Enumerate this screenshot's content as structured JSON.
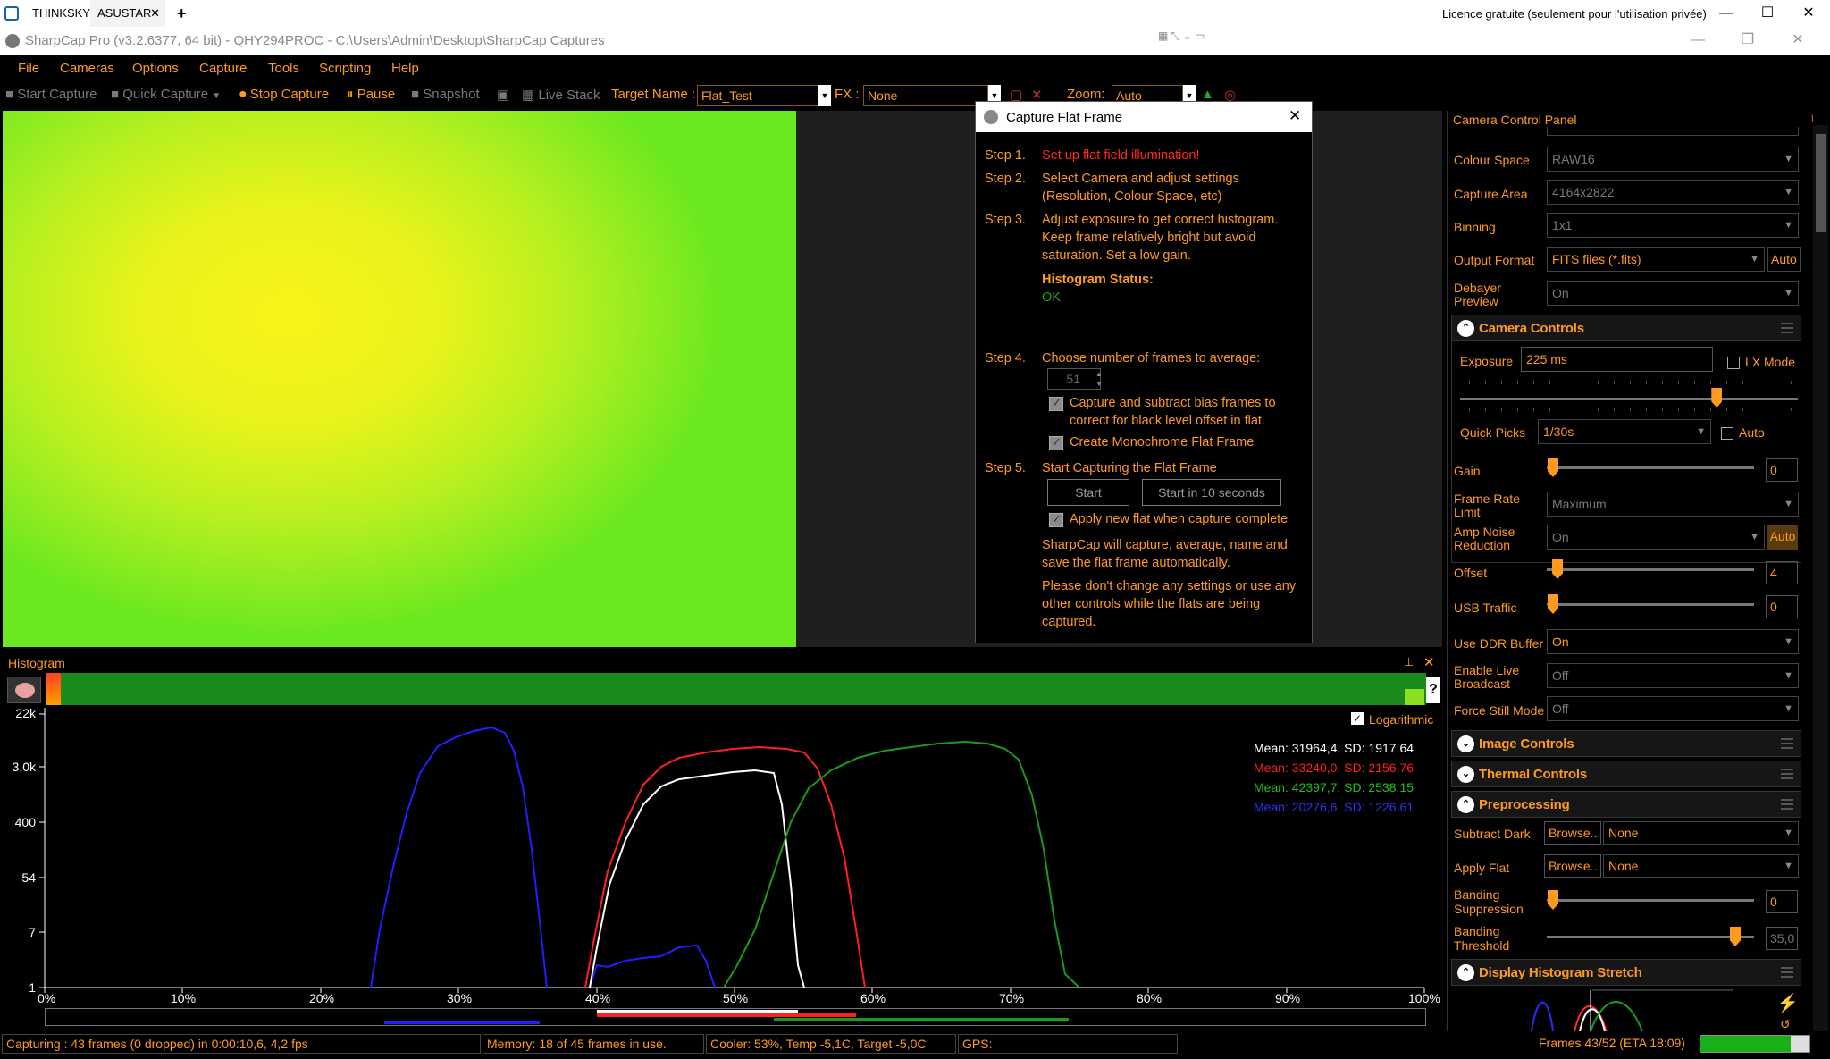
{
  "remote_tabs": [
    "THINKSKY",
    "ASUSTAR"
  ],
  "license_text": "Licence gratuite (seulement pour l'utilisation privée)",
  "window_title": "SharpCap Pro (v3.2.6377, 64 bit) - QHY294PROC - C:\\Users\\Admin\\Desktop\\SharpCap Captures",
  "menu": [
    "File",
    "Cameras",
    "Options",
    "Capture",
    "Tools",
    "Scripting",
    "Help"
  ],
  "toolbar": {
    "start_capture": "Start Capture",
    "quick_capture": "Quick Capture",
    "stop_capture": "Stop Capture",
    "pause": "Pause",
    "snapshot": "Snapshot",
    "live_stack": "Live Stack",
    "target_name_label": "Target Name :",
    "target_name_value": "Flat_Test",
    "fx_label": "FX :",
    "fx_value": "None",
    "zoom_label": "Zoom:",
    "zoom_value": "Auto"
  },
  "dialog": {
    "title": "Capture Flat Frame",
    "step1_label": "Step 1.",
    "step1_text": "Set up flat field illumination!",
    "step2_label": "Step 2.",
    "step2_line1": "Select Camera and adjust settings",
    "step2_line2": "(Resolution, Colour Space, etc)",
    "step3_label": "Step 3.",
    "step3_line1": "Adjust exposure to get correct histogram.",
    "step3_line2": "Keep frame relatively bright but avoid",
    "step3_line3": "saturation. Set a low gain.",
    "hist_status_label": "Histogram Status:",
    "hist_status_value": "OK",
    "step4_label": "Step 4.",
    "step4_text": "Choose number of frames to average:",
    "frames_value": "51",
    "bias_line1": "Capture and subtract bias frames to",
    "bias_line2": "correct for black level offset in flat.",
    "mono_text": "Create Monochrome Flat Frame",
    "step5_label": "Step 5.",
    "step5_text": "Start Capturing the Flat Frame",
    "start_button": "Start",
    "start10_button": "Start in 10 seconds",
    "apply_text": "Apply new flat when capture complete",
    "info1_line1": "SharpCap will capture, average, name and",
    "info1_line2": "save the flat frame automatically.",
    "info2_line1": "Please don't change any settings or use any",
    "info2_line2": "other controls while the flats are being",
    "info2_line3": "captured."
  },
  "panel": {
    "title": "Camera Control Panel",
    "colour_space_label": "Colour Space",
    "colour_space_value": "RAW16",
    "capture_area_label": "Capture Area",
    "capture_area_value": "4164x2822",
    "binning_label": "Binning",
    "binning_value": "1x1",
    "output_format_label": "Output Format",
    "output_format_value": "FITS files (*.fits)",
    "auto_label": "Auto",
    "debayer_label1": "Debayer",
    "debayer_label2": "Preview",
    "debayer_value": "On",
    "camera_controls": "Camera Controls",
    "exposure_label": "Exposure",
    "exposure_value": "225 ms",
    "lx_mode": "LX Mode",
    "exposure_slider_pct": 76,
    "quick_picks_label": "Quick Picks",
    "quick_picks_value": "1/30s",
    "quick_auto": "Auto",
    "gain_label": "Gain",
    "gain_value": "0",
    "frame_rate_label1": "Frame Rate",
    "frame_rate_label2": "Limit",
    "frame_rate_value": "Maximum",
    "amp_label1": "Amp Noise",
    "amp_label2": "Reduction",
    "amp_value": "On",
    "amp_auto": "Auto",
    "offset_label": "Offset",
    "offset_value": "4",
    "usb_label": "USB Traffic",
    "usb_value": "0",
    "ddr_label": "Use DDR Buffer",
    "ddr_value": "On",
    "broadcast_label1": "Enable Live",
    "broadcast_label2": "Broadcast",
    "broadcast_value": "Off",
    "still_label": "Force Still Mode",
    "still_value": "Off",
    "image_controls": "Image Controls",
    "thermal_controls": "Thermal Controls",
    "preprocessing": "Preprocessing",
    "subtract_dark_label": "Subtract Dark",
    "browse": "Browse...",
    "subtract_dark_value": "None",
    "apply_flat_label": "Apply Flat",
    "apply_flat_value": "None",
    "banding_supp_label1": "Banding",
    "banding_supp_label2": "Suppression",
    "banding_supp_value": "0",
    "banding_thr_label1": "Banding",
    "banding_thr_label2": "Threshold",
    "banding_thr_value": "35,0",
    "display_stretch": "Display Histogram Stretch"
  },
  "histogram": {
    "title": "Histogram",
    "logarithmic": "Logarithmic",
    "help": "?",
    "stats": [
      {
        "text": "Mean: 31964,4, SD: 1917,64",
        "color": "#ffffff"
      },
      {
        "text": "Mean: 33240,0, SD: 2156,76",
        "color": "#ff2020"
      },
      {
        "text": "Mean: 42397,7, SD: 2538,15",
        "color": "#20c020"
      },
      {
        "text": "Mean: 20276,6, SD: 1226,61",
        "color": "#3030ff"
      }
    ],
    "y_ticks": [
      "22k",
      "3,0k",
      "400",
      "54",
      "7",
      "1"
    ],
    "x_ticks": [
      "0%",
      "10%",
      "20%",
      "30%",
      "40%",
      "50%",
      "60%",
      "70%",
      "80%",
      "90%",
      "100%"
    ]
  },
  "status": {
    "capturing": "Capturing : 43 frames (0 dropped) in 0:00:10,6, 4,2 fps",
    "memory": "Memory: 18 of 45 frames in use.",
    "cooler": "Cooler: 53%, Temp -5,1C, Target -5,0C",
    "gps": "GPS:",
    "frames": "Frames 43/52 (ETA 18:09)",
    "progress_pct": 83
  }
}
